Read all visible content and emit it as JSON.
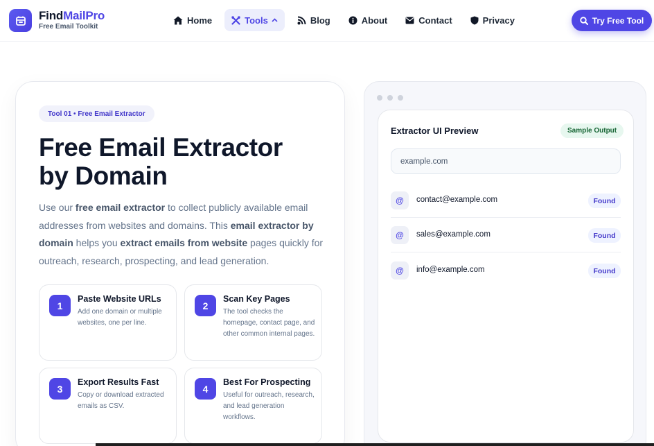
{
  "header": {
    "brand_name_main": "Find",
    "brand_name_accent": "MailPro",
    "brand_subtitle": "Free Email Toolkit",
    "logo_icon": "mail-box-icon",
    "nav": [
      {
        "label": "Home",
        "icon": "home-icon"
      },
      {
        "label": "Tools",
        "icon": "tools-icon",
        "active": true
      },
      {
        "label": "Blog",
        "icon": "rss-icon"
      },
      {
        "label": "About",
        "icon": "info-icon"
      },
      {
        "label": "Contact",
        "icon": "envelope-icon"
      },
      {
        "label": "Privacy",
        "icon": "shield-icon"
      }
    ],
    "cta_label": "Try Free Tool",
    "accent_color": "#4f46e5"
  },
  "hero": {
    "tag": "Tool 01 • Free Email Extractor",
    "headline_line1": "Free Email Extractor",
    "headline_line2": "by Domain",
    "intro_parts": [
      "Use our ",
      "free email extractor",
      " to collect publicly available email addresses from websites and domains. This ",
      "email extractor by domain",
      " helps you ",
      "extract emails from website",
      " pages quickly for outreach, research, prospecting, and lead generation."
    ],
    "steps": [
      {
        "num": "1",
        "title": "Paste Website URLs",
        "desc": "Add one domain or multiple websites, one per line."
      },
      {
        "num": "2",
        "title": "Scan Key Pages",
        "desc": "The tool checks the homepage, contact page, and other common internal pages."
      },
      {
        "num": "3",
        "title": "Export Results Fast",
        "desc": "Copy or download extracted emails as CSV."
      },
      {
        "num": "4",
        "title": "Best For Prospecting",
        "desc": "Useful for outreach, research, and lead generation workflows."
      }
    ]
  },
  "preview": {
    "title": "Extractor UI Preview",
    "badge": "Sample Output",
    "input_value": "example.com",
    "results": [
      {
        "icon": "@",
        "email": "contact@example.com",
        "status": "Found"
      },
      {
        "icon": "@",
        "email": "sales@example.com",
        "status": "Found"
      },
      {
        "icon": "@",
        "email": "info@example.com",
        "status": "Found"
      }
    ]
  }
}
